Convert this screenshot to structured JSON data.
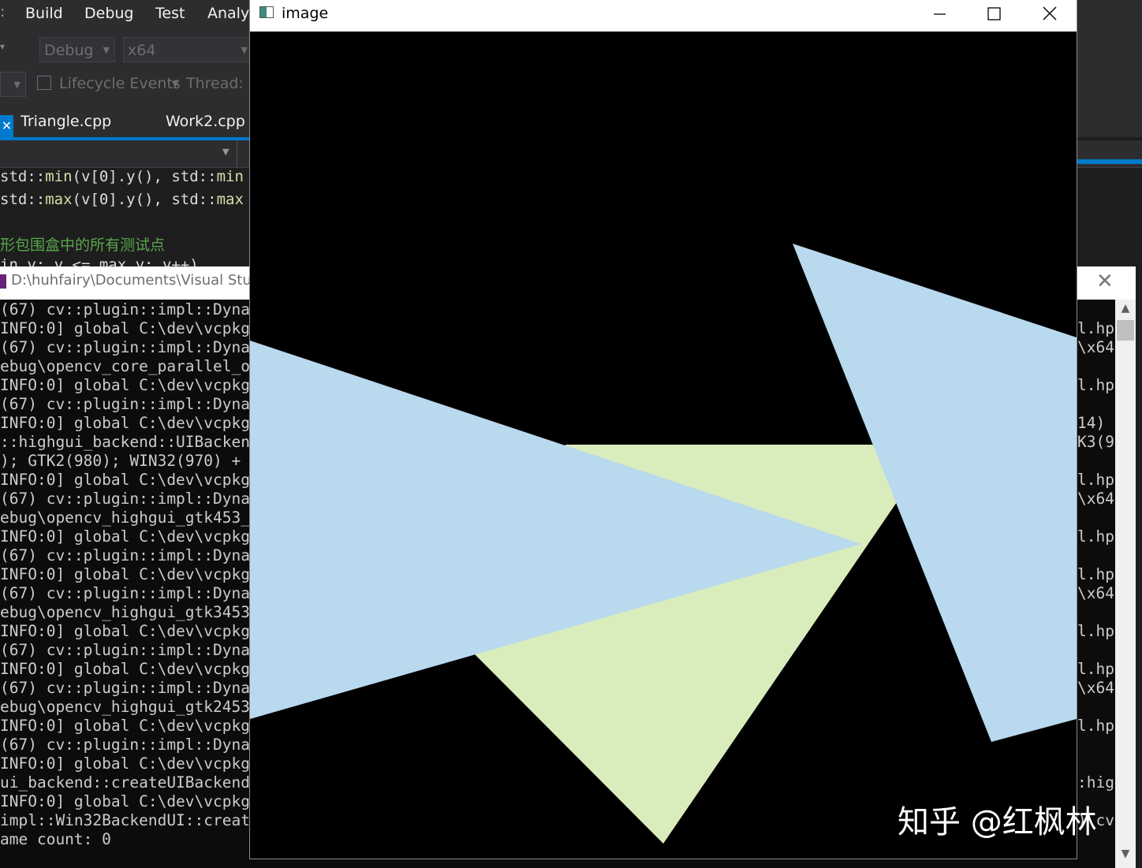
{
  "vs": {
    "menu": [
      "Build",
      "Debug",
      "Test",
      "Analyz"
    ],
    "toolbar": {
      "config": "Debug",
      "platform": "x64",
      "lifecycle": "Lifecycle Events",
      "thread_label": "Thread:"
    },
    "tabs": [
      "Triangle.cpp",
      "Work2.cpp"
    ],
    "code": {
      "line1": {
        "a": "std::",
        "b": "min",
        "c": "(v[0].y(), std::",
        "d": "min"
      },
      "line2": {
        "a": "std::",
        "b": "max",
        "c": "(v[0].y(), std::",
        "d": "max"
      },
      "comment": "形包围盒中的所有测试点",
      "partial": "in y: y <= max_y; y++)"
    }
  },
  "console": {
    "title": "D:\\huhfairy\\Documents\\Visual Stud",
    "lines": [
      "(67) cv::plugin::impl::Dyna",
      "INFO:0] global C:\\dev\\vcpkg",
      "(67) cv::plugin::impl::Dyna",
      "ebug\\opencv_core_parallel_o",
      "INFO:0] global C:\\dev\\vcpkg",
      "(67) cv::plugin::impl::Dyna",
      "INFO:0] global C:\\dev\\vcpkg",
      "::highgui_backend::UIBacken",
      "); GTK2(980); WIN32(970) +",
      "INFO:0] global C:\\dev\\vcpkg",
      "(67) cv::plugin::impl::Dyna",
      "ebug\\opencv_highgui_gtk453_",
      "INFO:0] global C:\\dev\\vcpkg",
      "(67) cv::plugin::impl::Dyna",
      "INFO:0] global C:\\dev\\vcpkg",
      "(67) cv::plugin::impl::Dyna",
      "ebug\\opencv_highgui_gtk3453",
      "INFO:0] global C:\\dev\\vcpkg",
      "(67) cv::plugin::impl::Dyna",
      "INFO:0] global C:\\dev\\vcpkg",
      "(67) cv::plugin::impl::Dyna",
      "ebug\\opencv_highgui_gtk2453",
      "INFO:0] global C:\\dev\\vcpkg",
      "(67) cv::plugin::impl::Dyna",
      "INFO:0] global C:\\dev\\vcpkg",
      "ui_backend::createUIBackend",
      "INFO:0] global C:\\dev\\vcpkg",
      "impl::Win32BackendUI::creat",
      "ame count: 0"
    ],
    "right": [
      "l.hp",
      "\\x64",
      "",
      "l.hp",
      "",
      "14)",
      "K3(9",
      "",
      "l.hp",
      "\\x64",
      "",
      "l.hp",
      "",
      "l.hp",
      "\\x64",
      "",
      "l.hp",
      "",
      "l.hp",
      "\\x64",
      "",
      "l.hp",
      "",
      "",
      ":hig",
      "",
      ") cv"
    ]
  },
  "image_window": {
    "title": "image",
    "watermark": "知乎 @红枫林",
    "colors": {
      "blue_triangle": "#b9d9ee",
      "green_triangle": "#d9edbc",
      "background": "#000000"
    }
  }
}
